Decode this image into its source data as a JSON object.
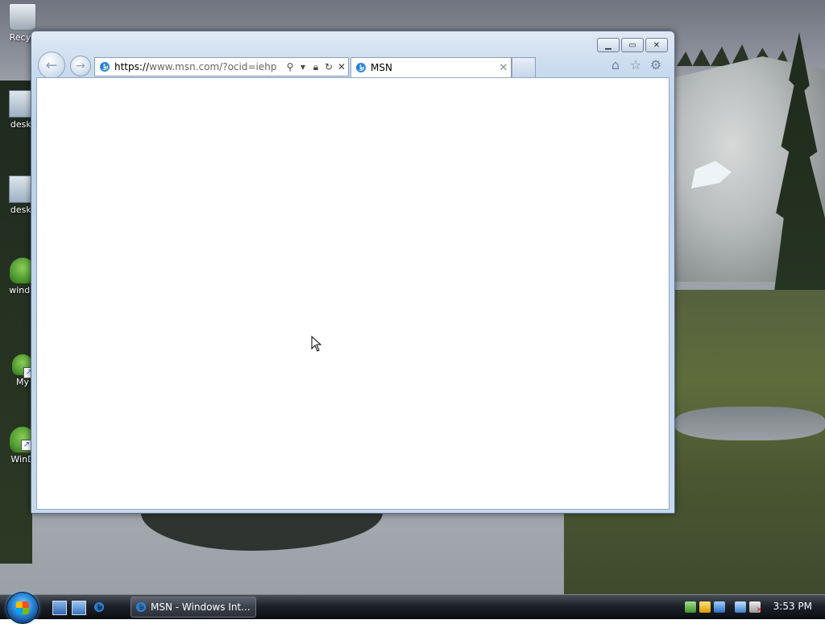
{
  "desktop": {
    "icons": [
      {
        "label": "Recyc"
      },
      {
        "label": "deskt"
      },
      {
        "label": "deskt"
      },
      {
        "label": "windir"
      },
      {
        "label": "My"
      },
      {
        "label": "WinD"
      }
    ]
  },
  "browser": {
    "address": {
      "scheme": "https://",
      "rest": "www.msn.com/?ocid=iehp"
    },
    "tab": {
      "title": "MSN"
    },
    "icons": {
      "search": "search-icon",
      "lock": "lock-icon",
      "refresh": "refresh-icon",
      "stop": "stop-icon",
      "home": "home-icon",
      "favorites": "star-icon",
      "tools": "gear-icon"
    }
  },
  "taskbar": {
    "task_button": "MSN - Windows Int...",
    "clock": "3:53 PM"
  },
  "colors": {
    "window_frame": "#c6d8ec",
    "taskbar": "#1d2129",
    "accent": "#2e8de0"
  }
}
